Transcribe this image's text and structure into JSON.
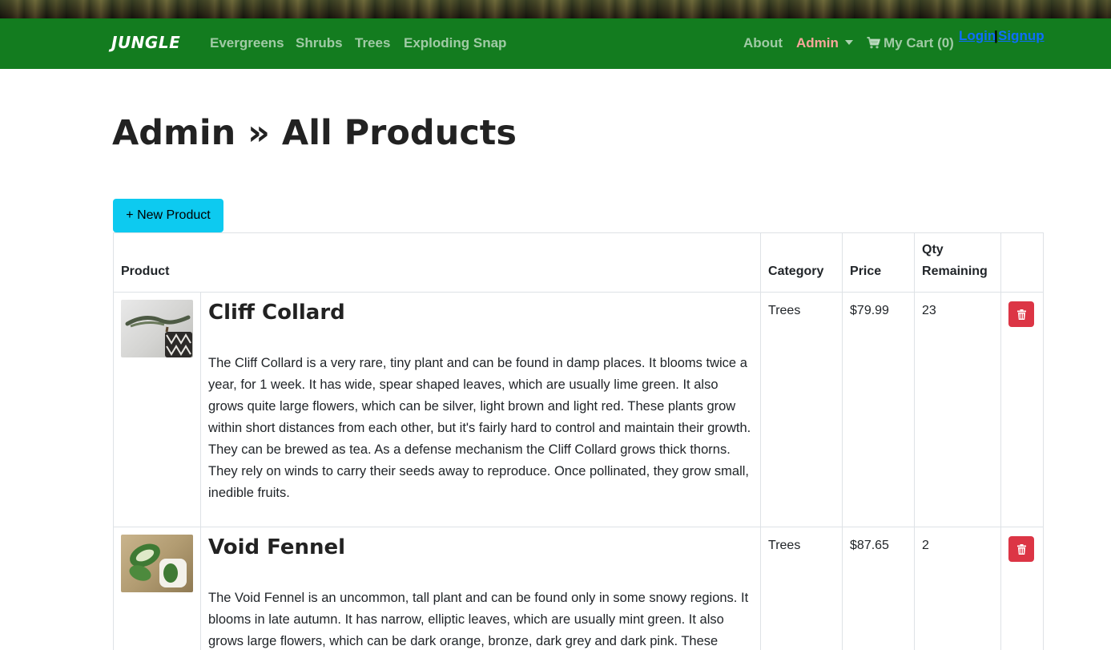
{
  "nav": {
    "brand": "JUNGLE",
    "categories": [
      "Evergreens",
      "Shrubs",
      "Trees",
      "Exploding Snap"
    ],
    "about": "About",
    "admin": "Admin",
    "cart": "My Cart (0)",
    "login": "Login",
    "separator": "|",
    "signup": "Signup"
  },
  "page": {
    "title": "Admin » All Products",
    "new_product_button": "+ New Product"
  },
  "table": {
    "headers": {
      "product": "Product",
      "category": "Category",
      "price": "Price",
      "qty_line1": "Qty",
      "qty_line2": "Remaining"
    },
    "rows": [
      {
        "name": "Cliff Collard",
        "description": "The Cliff Collard is a very rare, tiny plant and can be found in damp places. It blooms twice a year, for 1 week. It has wide, spear shaped leaves, which are usually lime green. It also grows quite large flowers, which can be silver, light brown and light red. These plants grow within short distances from each other, but it's fairly hard to control and maintain their growth. They can be brewed as tea. As a defense mechanism the Cliff Collard grows thick thorns. They rely on winds to carry their seeds away to reproduce. Once pollinated, they grow small, inedible fruits.",
        "category": "Trees",
        "price": "$79.99",
        "qty": "23"
      },
      {
        "name": "Void Fennel",
        "description": "The Void Fennel is an uncommon, tall plant and can be found only in some snowy regions. It blooms in late autumn. It has narrow, elliptic leaves, which are usually mint green. It also grows large flowers, which can be dark orange, bronze, dark grey and dark pink. These",
        "category": "Trees",
        "price": "$87.65",
        "qty": "2"
      }
    ]
  },
  "colors": {
    "navbar": "#137c1f",
    "admin_link": "#f7a69a",
    "auth_link": "#0d6efd",
    "new_button": "#0dcaf0",
    "delete_button": "#dc3545"
  },
  "icons": {
    "cart": "shopping-cart-icon",
    "delete": "trash-icon",
    "dropdown": "caret-down-icon"
  }
}
